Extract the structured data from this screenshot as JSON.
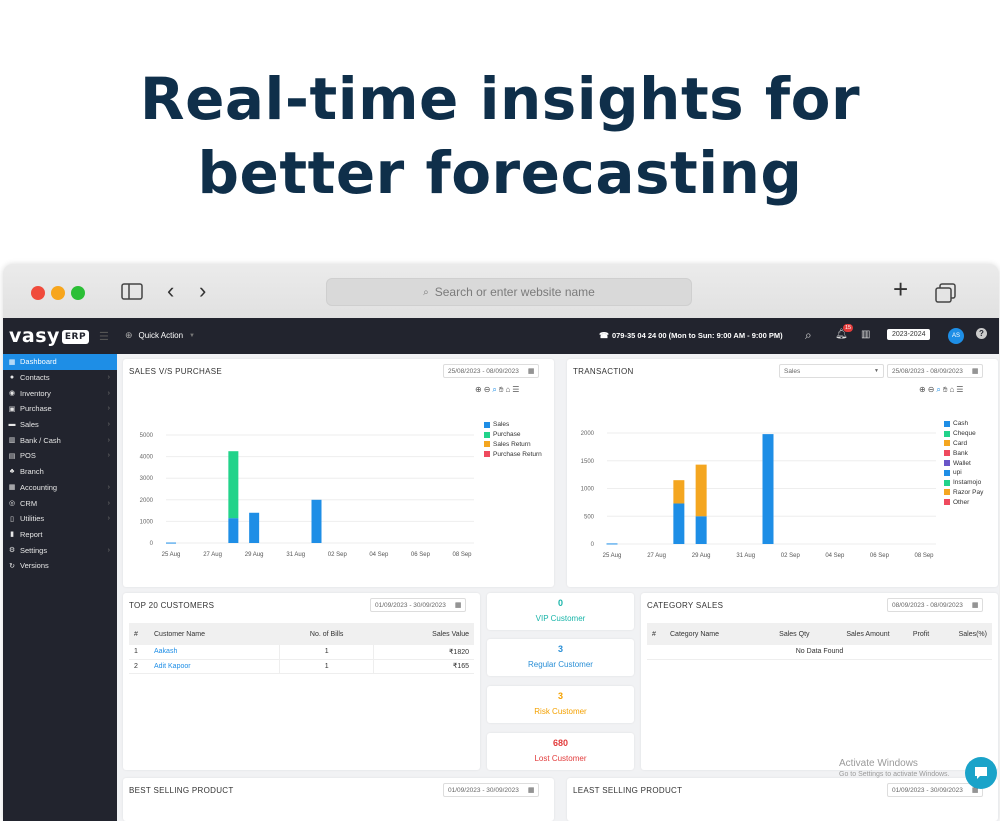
{
  "headline": {
    "line1": "Real-time insights for",
    "line2": "better forecasting"
  },
  "browser": {
    "url_placeholder": "Search or enter website name"
  },
  "topbar": {
    "logo": "vasy",
    "logo_badge": "ERP",
    "quick_action": "Quick Action",
    "phone": "079-35 04 24 00 (Mon to Sun: 9:00 AM - 9:00 PM)",
    "notification_count": "15",
    "year": "2023-2024",
    "avatar": "AS"
  },
  "sidebar": {
    "items": [
      {
        "label": "Dashboard",
        "icon": "▦",
        "arrow": ""
      },
      {
        "label": "Contacts",
        "icon": "●",
        "arrow": "›"
      },
      {
        "label": "Inventory",
        "icon": "◉",
        "arrow": "›"
      },
      {
        "label": "Purchase",
        "icon": "▣",
        "arrow": "›"
      },
      {
        "label": "Sales",
        "icon": "▬",
        "arrow": "›"
      },
      {
        "label": "Bank / Cash",
        "icon": "▥",
        "arrow": "›"
      },
      {
        "label": "POS",
        "icon": "▤",
        "arrow": "›"
      },
      {
        "label": "Branch",
        "icon": "♣",
        "arrow": ""
      },
      {
        "label": "Accounting",
        "icon": "▦",
        "arrow": "›"
      },
      {
        "label": "CRM",
        "icon": "◎",
        "arrow": "›"
      },
      {
        "label": "Utilities",
        "icon": "▯",
        "arrow": "›"
      },
      {
        "label": "Report",
        "icon": "▮",
        "arrow": ""
      },
      {
        "label": "Settings",
        "icon": "⚙",
        "arrow": "›"
      },
      {
        "label": "Versions",
        "icon": "↻",
        "arrow": ""
      }
    ]
  },
  "sales_purchase": {
    "title": "SALES V/S PURCHASE",
    "date_range": "25/08/2023 - 08/09/2023"
  },
  "transaction": {
    "title": "TRANSACTION",
    "filter": "Sales",
    "date_range": "25/08/2023 - 08/09/2023"
  },
  "top_customers": {
    "title": "TOP 20 CUSTOMERS",
    "date_range": "01/09/2023 - 30/09/2023",
    "columns": [
      "#",
      "Customer Name",
      "No. of Bills",
      "Sales Value"
    ],
    "rows": [
      {
        "n": "1",
        "name": "Aakash",
        "bills": "1",
        "value": "₹1820"
      },
      {
        "n": "2",
        "name": "Adit Kapoor",
        "bills": "1",
        "value": "₹165"
      }
    ]
  },
  "kpis": [
    {
      "value": "0",
      "label": "VIP Customer",
      "color": "#19b5a9"
    },
    {
      "value": "3",
      "label": "Regular Customer",
      "color": "#2a8fd6"
    },
    {
      "value": "3",
      "label": "Risk Customer",
      "color": "#f4a100"
    },
    {
      "value": "680",
      "label": "Lost Customer",
      "color": "#e23b3b"
    }
  ],
  "category_sales": {
    "title": "CATEGORY SALES",
    "date_range": "08/09/2023 - 08/09/2023",
    "columns": [
      "#",
      "Category Name",
      "Sales Qty",
      "Sales Amount",
      "Profit",
      "Sales(%)"
    ],
    "empty": "No Data Found"
  },
  "best_selling": {
    "title": "BEST SELLING PRODUCT",
    "date_range": "01/09/2023 - 30/09/2023"
  },
  "least_selling": {
    "title": "LEAST SELLING PRODUCT",
    "date_range": "01/09/2023 - 30/09/2023"
  },
  "watermark": {
    "line1": "Activate Windows",
    "line2": "Go to Settings to activate Windows."
  },
  "chart_data": [
    {
      "type": "bar",
      "stacked": true,
      "categories": [
        "25 Aug",
        "26 Aug",
        "27 Aug",
        "28 Aug",
        "29 Aug",
        "30 Aug",
        "31 Aug",
        "01 Sep",
        "02 Sep",
        "03 Sep",
        "04 Sep",
        "05 Sep",
        "06 Sep",
        "07 Sep",
        "08 Sep"
      ],
      "tick_labels": [
        "25 Aug",
        "27 Aug",
        "29 Aug",
        "31 Aug",
        "02 Sep",
        "04 Sep",
        "06 Sep",
        "08 Sep"
      ],
      "y_ticks": [
        "0",
        "1000",
        "2000",
        "3000",
        "4000",
        "5000"
      ],
      "ylim": [
        0,
        5000
      ],
      "legend_position": "right",
      "series": [
        {
          "name": "Sales",
          "color": "#1e8ee6",
          "values": [
            20,
            0,
            0,
            1150,
            1400,
            0,
            0,
            2000,
            0,
            0,
            0,
            0,
            0,
            0,
            0
          ]
        },
        {
          "name": "Purchase",
          "color": "#22d38a",
          "values": [
            0,
            0,
            0,
            3100,
            0,
            0,
            0,
            0,
            0,
            0,
            0,
            0,
            0,
            0,
            0
          ]
        },
        {
          "name": "Sales Return",
          "color": "#f4a620",
          "values": [
            0,
            0,
            0,
            0,
            0,
            0,
            0,
            0,
            0,
            0,
            0,
            0,
            0,
            0,
            0
          ]
        },
        {
          "name": "Purchase Return",
          "color": "#ef4a5e",
          "values": [
            0,
            0,
            0,
            0,
            0,
            0,
            0,
            0,
            0,
            0,
            0,
            0,
            0,
            0,
            0
          ]
        }
      ]
    },
    {
      "type": "bar",
      "stacked": true,
      "categories": [
        "25 Aug",
        "26 Aug",
        "27 Aug",
        "28 Aug",
        "29 Aug",
        "30 Aug",
        "31 Aug",
        "01 Sep",
        "02 Sep",
        "03 Sep",
        "04 Sep",
        "05 Sep",
        "06 Sep",
        "07 Sep",
        "08 Sep"
      ],
      "tick_labels": [
        "25 Aug",
        "27 Aug",
        "29 Aug",
        "31 Aug",
        "02 Sep",
        "04 Sep",
        "06 Sep",
        "08 Sep"
      ],
      "y_ticks": [
        "0",
        "500",
        "1000",
        "1500",
        "2000"
      ],
      "ylim": [
        0,
        2000
      ],
      "legend_position": "right",
      "series": [
        {
          "name": "Cash",
          "color": "#1e8ee6",
          "values": [
            10,
            0,
            0,
            730,
            500,
            0,
            0,
            1980,
            0,
            0,
            0,
            0,
            0,
            0,
            0
          ]
        },
        {
          "name": "Cheque",
          "color": "#22d38a",
          "values": [
            0,
            0,
            0,
            0,
            0,
            0,
            0,
            0,
            0,
            0,
            0,
            0,
            0,
            0,
            0
          ]
        },
        {
          "name": "Card",
          "color": "#f4a620",
          "values": [
            0,
            0,
            0,
            420,
            930,
            0,
            0,
            0,
            0,
            0,
            0,
            0,
            0,
            0,
            0
          ]
        },
        {
          "name": "Bank",
          "color": "#ef4a5e",
          "values": [
            0,
            0,
            0,
            0,
            0,
            0,
            0,
            0,
            0,
            0,
            0,
            0,
            0,
            0,
            0
          ]
        },
        {
          "name": "Wallet",
          "color": "#6a55c8",
          "values": [
            0,
            0,
            0,
            0,
            0,
            0,
            0,
            0,
            0,
            0,
            0,
            0,
            0,
            0,
            0
          ]
        },
        {
          "name": "upi",
          "color": "#1e8ee6",
          "values": [
            0,
            0,
            0,
            0,
            0,
            0,
            0,
            0,
            0,
            0,
            0,
            0,
            0,
            0,
            0
          ]
        },
        {
          "name": "Instamojo",
          "color": "#22d38a",
          "values": [
            0,
            0,
            0,
            0,
            0,
            0,
            0,
            0,
            0,
            0,
            0,
            0,
            0,
            0,
            0
          ]
        },
        {
          "name": "Razor Pay",
          "color": "#f4a620",
          "values": [
            0,
            0,
            0,
            0,
            0,
            0,
            0,
            0,
            0,
            0,
            0,
            0,
            0,
            0,
            0
          ]
        },
        {
          "name": "Other",
          "color": "#ef4a5e",
          "values": [
            0,
            0,
            0,
            0,
            0,
            0,
            0,
            0,
            0,
            0,
            0,
            0,
            0,
            0,
            0
          ]
        }
      ]
    }
  ]
}
